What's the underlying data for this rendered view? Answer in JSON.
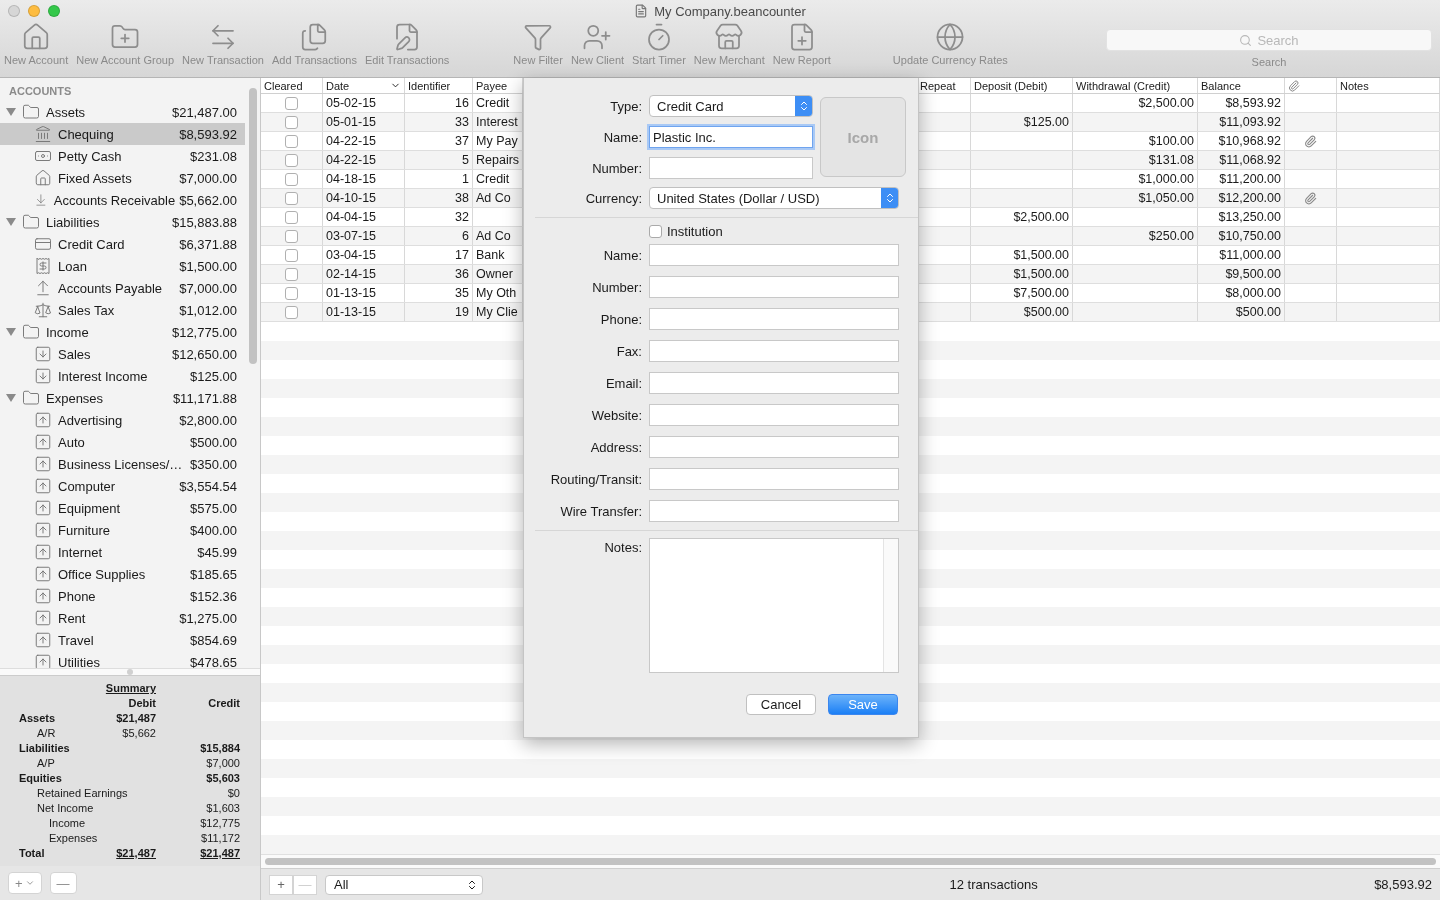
{
  "window": {
    "title": "My Company.beancounter"
  },
  "toolbar": {
    "groups": [
      [
        {
          "label": "New Account",
          "kind": "account"
        },
        {
          "label": "New Account Group",
          "kind": "group"
        },
        {
          "label": "New Transaction",
          "kind": "transaction"
        },
        {
          "label": "Add Transactions",
          "kind": "add"
        },
        {
          "label": "Edit Transactions",
          "kind": "edit"
        }
      ],
      [
        {
          "label": "New Filter",
          "kind": "filter"
        },
        {
          "label": "New Client",
          "kind": "client"
        },
        {
          "label": "Start Timer",
          "kind": "timer"
        },
        {
          "label": "New Merchant",
          "kind": "merchant"
        },
        {
          "label": "New Report",
          "kind": "report"
        }
      ],
      [
        {
          "label": "Update Currency Rates",
          "kind": "currency"
        }
      ]
    ],
    "search": {
      "placeholder": "Search",
      "label": "Search"
    }
  },
  "sidebar": {
    "heading": "ACCOUNTS",
    "accounts": [
      {
        "name": "Assets",
        "amount": "$21,487.00",
        "kind": "folder",
        "expanded": true,
        "selected": false,
        "children": [
          {
            "name": "Chequing",
            "amount": "$8,593.92",
            "kind": "bank",
            "selected": true
          },
          {
            "name": "Petty Cash",
            "amount": "$231.08",
            "kind": "cash",
            "selected": false
          },
          {
            "name": "Fixed Assets",
            "amount": "$7,000.00",
            "kind": "property",
            "selected": false
          },
          {
            "name": "Accounts Receivable",
            "amount": "$5,662.00",
            "kind": "receivable",
            "selected": false
          }
        ]
      },
      {
        "name": "Liabilities",
        "amount": "$15,883.88",
        "kind": "folder",
        "expanded": true,
        "selected": false,
        "children": [
          {
            "name": "Credit Card",
            "amount": "$6,371.88",
            "kind": "card",
            "selected": false
          },
          {
            "name": "Loan",
            "amount": "$1,500.00",
            "kind": "loan",
            "selected": false
          },
          {
            "name": "Accounts Payable",
            "amount": "$7,000.00",
            "kind": "payable",
            "selected": false
          },
          {
            "name": "Sales Tax",
            "amount": "$1,012.00",
            "kind": "tax",
            "selected": false
          }
        ]
      },
      {
        "name": "Income",
        "amount": "$12,775.00",
        "kind": "folder",
        "expanded": true,
        "selected": false,
        "children": [
          {
            "name": "Sales",
            "amount": "$12,650.00",
            "kind": "income",
            "selected": false
          },
          {
            "name": "Interest Income",
            "amount": "$125.00",
            "kind": "income",
            "selected": false
          }
        ]
      },
      {
        "name": "Expenses",
        "amount": "$11,171.88",
        "kind": "folder",
        "expanded": true,
        "selected": false,
        "children": [
          {
            "name": "Advertising",
            "amount": "$2,800.00",
            "kind": "expense",
            "selected": false
          },
          {
            "name": "Auto",
            "amount": "$500.00",
            "kind": "expense",
            "selected": false
          },
          {
            "name": "Business Licenses/…",
            "amount": "$350.00",
            "kind": "expense",
            "selected": false
          },
          {
            "name": "Computer",
            "amount": "$3,554.54",
            "kind": "expense",
            "selected": false
          },
          {
            "name": "Equipment",
            "amount": "$575.00",
            "kind": "expense",
            "selected": false
          },
          {
            "name": "Furniture",
            "amount": "$400.00",
            "kind": "expense",
            "selected": false
          },
          {
            "name": "Internet",
            "amount": "$45.99",
            "kind": "expense",
            "selected": false
          },
          {
            "name": "Office Supplies",
            "amount": "$185.65",
            "kind": "expense",
            "selected": false
          },
          {
            "name": "Phone",
            "amount": "$152.36",
            "kind": "expense",
            "selected": false
          },
          {
            "name": "Rent",
            "amount": "$1,275.00",
            "kind": "expense",
            "selected": false
          },
          {
            "name": "Travel",
            "amount": "$854.69",
            "kind": "expense",
            "selected": false
          },
          {
            "name": "Utilities",
            "amount": "$478.65",
            "kind": "expense",
            "selected": false
          }
        ]
      }
    ]
  },
  "summary": {
    "title": "Summary",
    "debit_heading": "Debit",
    "credit_heading": "Credit",
    "rows": [
      {
        "label": "Assets",
        "debit": "$21,487",
        "children": [
          {
            "label": "A/R",
            "debit": "$5,662"
          }
        ]
      },
      {
        "label": "Liabilities",
        "credit": "$15,884",
        "children": [
          {
            "label": "A/P",
            "credit": "$7,000"
          }
        ]
      },
      {
        "label": "Equities",
        "credit": "$5,603",
        "children": [
          {
            "label": "Retained Earnings",
            "credit": "$0"
          },
          {
            "label": "Net Income",
            "credit": "$1,603",
            "children": [
              {
                "label": "Income",
                "credit": "$12,775"
              },
              {
                "label": "Expenses",
                "credit": "$11,172"
              }
            ]
          }
        ]
      },
      {
        "label": "Total",
        "debit": "$21,487",
        "credit": "$21,487",
        "kind": "total"
      }
    ]
  },
  "sidebar_bottom": {
    "add": "+",
    "remove": "—"
  },
  "table": {
    "columns": [
      {
        "label": "Cleared",
        "sorted": false
      },
      {
        "label": "Date",
        "sorted": true
      },
      {
        "label": "Identifier",
        "sorted": false
      },
      {
        "label": "Payee",
        "sorted": false
      },
      {
        "label": "Repeat",
        "sorted": false
      },
      {
        "label": "Deposit (Debit)",
        "sorted": false
      },
      {
        "label": "Withdrawal (Credit)",
        "sorted": false
      },
      {
        "label": "Balance",
        "sorted": false
      },
      {
        "label": "Notes",
        "sorted": false
      }
    ],
    "rows": [
      {
        "cleared": false,
        "date": "05-02-15",
        "identifier": "16",
        "payee": "Credit",
        "withdrawal": "$2,500.00",
        "balance": "$8,593.92",
        "attachment": false
      },
      {
        "cleared": false,
        "date": "05-01-15",
        "identifier": "33",
        "payee": "Interest",
        "deposit": "$125.00",
        "balance": "$11,093.92",
        "attachment": false
      },
      {
        "cleared": false,
        "date": "04-22-15",
        "identifier": "37",
        "payee": "My Pay",
        "withdrawal": "$100.00",
        "balance": "$10,968.92",
        "attachment": true
      },
      {
        "cleared": false,
        "date": "04-22-15",
        "identifier": "5",
        "payee": "Repairs",
        "withdrawal": "$131.08",
        "balance": "$11,068.92",
        "attachment": false
      },
      {
        "cleared": false,
        "date": "04-18-15",
        "identifier": "1",
        "payee": "Credit",
        "withdrawal": "$1,000.00",
        "balance": "$11,200.00",
        "attachment": false
      },
      {
        "cleared": false,
        "date": "04-10-15",
        "identifier": "38",
        "payee": "Ad Co",
        "withdrawal": "$1,050.00",
        "balance": "$12,200.00",
        "attachment": true
      },
      {
        "cleared": false,
        "date": "04-04-15",
        "identifier": "32",
        "deposit": "$2,500.00",
        "balance": "$13,250.00",
        "attachment": false
      },
      {
        "cleared": false,
        "date": "03-07-15",
        "identifier": "6",
        "payee": "Ad Co",
        "withdrawal": "$250.00",
        "balance": "$10,750.00",
        "attachment": false
      },
      {
        "cleared": false,
        "date": "03-04-15",
        "identifier": "17",
        "payee": "Bank",
        "deposit": "$1,500.00",
        "balance": "$11,000.00",
        "attachment": false
      },
      {
        "cleared": false,
        "date": "02-14-15",
        "identifier": "36",
        "payee": "Owner",
        "deposit": "$1,500.00",
        "balance": "$9,500.00",
        "attachment": false
      },
      {
        "cleared": false,
        "date": "01-13-15",
        "identifier": "35",
        "payee": "My Oth",
        "deposit": "$7,500.00",
        "balance": "$8,000.00",
        "attachment": false
      },
      {
        "cleared": false,
        "date": "01-13-15",
        "identifier": "19",
        "payee": "My Clie",
        "deposit": "$500.00",
        "balance": "$500.00",
        "attachment": false
      }
    ]
  },
  "bottom_bar": {
    "add": "+",
    "remove": "—",
    "filter": "All",
    "count": "12 transactions",
    "balance": "$8,593.92"
  },
  "sheet": {
    "type": {
      "label": "Type:",
      "value": "Credit Card"
    },
    "name": {
      "label": "Name:",
      "value": "Plastic Inc."
    },
    "number": {
      "label": "Number:"
    },
    "icon": "Icon",
    "currency": {
      "label": "Currency:",
      "value": "United States (Dollar / USD)"
    },
    "institution": {
      "label": "Institution",
      "checked": false
    },
    "institution_fields": [
      {
        "label": "Name:"
      },
      {
        "label": "Number:"
      },
      {
        "label": "Phone:"
      },
      {
        "label": "Fax:"
      },
      {
        "label": "Email:"
      },
      {
        "label": "Website:"
      },
      {
        "label": "Address:"
      },
      {
        "label": "Routing/Transit:"
      },
      {
        "label": "Wire Transfer:"
      }
    ],
    "notes": {
      "label": "Notes:"
    },
    "buttons": [
      {
        "label": "Cancel",
        "kind": "cancel"
      },
      {
        "label": "Save",
        "kind": "default"
      }
    ]
  }
}
